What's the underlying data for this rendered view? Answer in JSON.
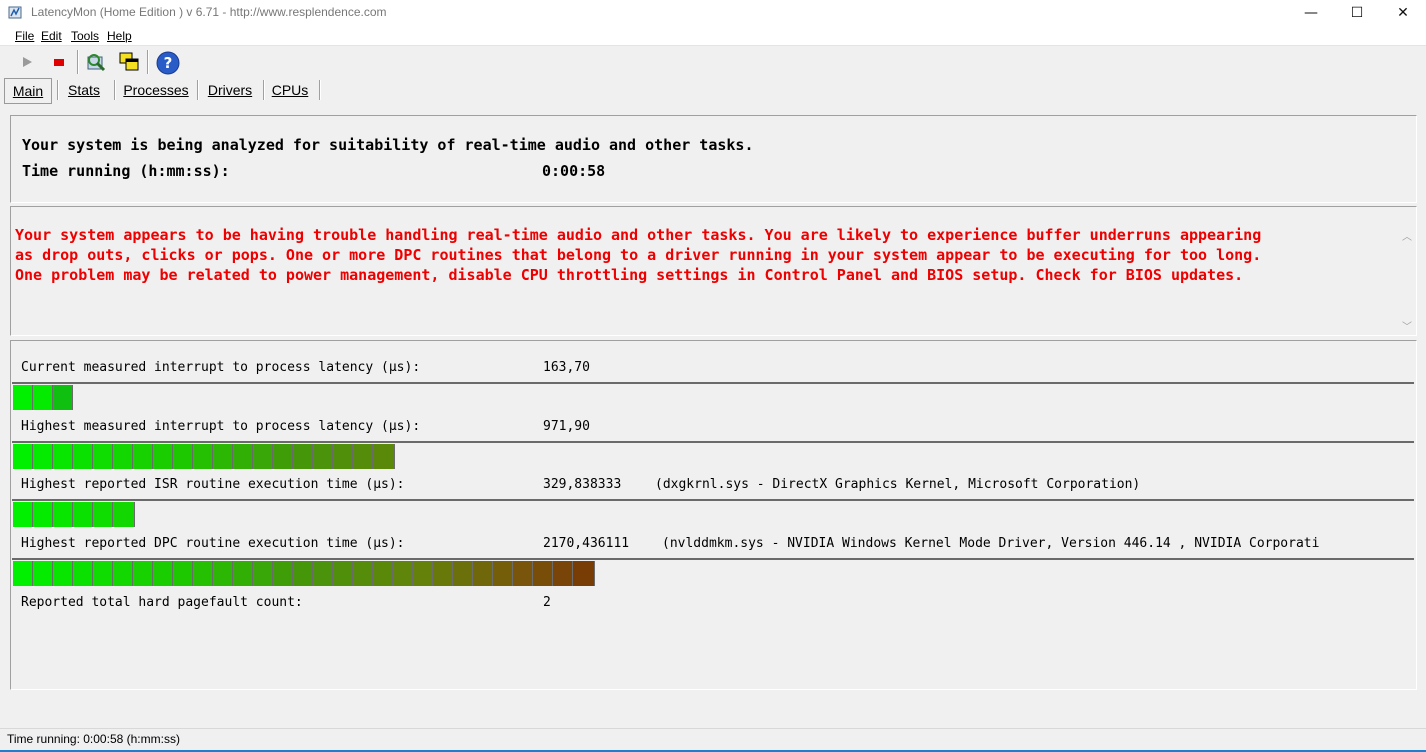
{
  "window": {
    "title": "LatencyMon  (Home Edition )  v 6.71 - http://www.resplendence.com",
    "controls": {
      "minimize": "—",
      "maximize": "☐",
      "close": "✕"
    }
  },
  "menu": [
    "File",
    "Edit",
    "Tools",
    "Help"
  ],
  "toolbar": {
    "icons": [
      "play-icon",
      "stop-icon",
      "analyze-icon",
      "window-icon",
      "help-icon"
    ]
  },
  "tabs": [
    "Main",
    "Stats",
    "Processes",
    "Drivers",
    "CPUs"
  ],
  "status_panel": {
    "line1": "Your system is being analyzed for suitability of real-time audio and other tasks.",
    "time_label": "Time running (h:mm:ss):",
    "time_value": "0:00:58"
  },
  "warning": {
    "line1": "Your system appears to be having trouble handling real-time audio and other tasks. You are likely to experience buffer underruns appearing",
    "line2": "as drop outs, clicks or pops. One or more DPC routines that belong to a driver running in your system appear to be executing for too long.",
    "line3": "One problem may be related to power management, disable CPU throttling settings in Control Panel and BIOS setup. Check for BIOS updates.",
    "color": "#ee0000"
  },
  "metrics": [
    {
      "label": "Current measured interrupt to process latency (µs):",
      "value": "163,70",
      "detail": "",
      "segments": 3
    },
    {
      "label": "Highest measured interrupt to process latency (µs):",
      "value": "971,90",
      "detail": "",
      "segments": 19
    },
    {
      "label": "Highest reported ISR routine execution time (µs):",
      "value": "329,838333",
      "detail": "(dxgkrnl.sys - DirectX Graphics Kernel, Microsoft Corporation)",
      "segments": 6
    },
    {
      "label": "Highest reported DPC routine execution time (µs):",
      "value": "2170,436111",
      "detail": "(nvlddmkm.sys - NVIDIA Windows Kernel Mode Driver, Version 446.14 , NVIDIA Corporati",
      "segments": 29
    }
  ],
  "pagefault": {
    "label": "Reported total hard pagefault count:",
    "value": "2"
  },
  "statusbar": {
    "text": "Time running: 0:00:58  (h:mm:ss)"
  }
}
